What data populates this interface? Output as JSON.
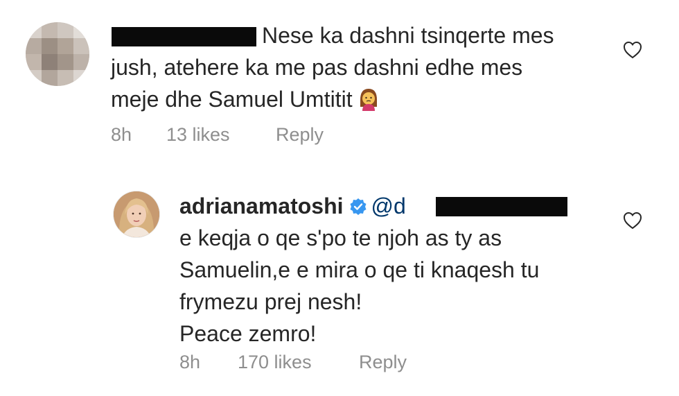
{
  "comment1": {
    "text_line1": "Nese ka dashni tsinqerte mes",
    "text_line2": "jush, atehere ka me pas dashni edhe mes",
    "text_line3": "meje dhe Samuel Umtitit",
    "emoji": "woman-gesturing-no-emoji",
    "time": "8h",
    "likes": "13 likes",
    "reply": "Reply"
  },
  "comment2": {
    "username": "adrianamatoshi",
    "mention": "@d",
    "text_line1": "e keqja o qe s'po te njoh as ty as",
    "text_line2": "Samuelin,e e mira o qe ti knaqesh tu",
    "text_line3": "frymezu prej nesh!",
    "text_line4": "Peace zemro!",
    "time": "8h",
    "likes": "170 likes",
    "reply": "Reply"
  },
  "icons": {
    "heart": "heart-outline-icon",
    "verified": "verified-badge-icon"
  },
  "colors": {
    "text": "#262626",
    "meta": "#8e8e8e",
    "verified": "#3897f0",
    "mention": "#00376b"
  }
}
